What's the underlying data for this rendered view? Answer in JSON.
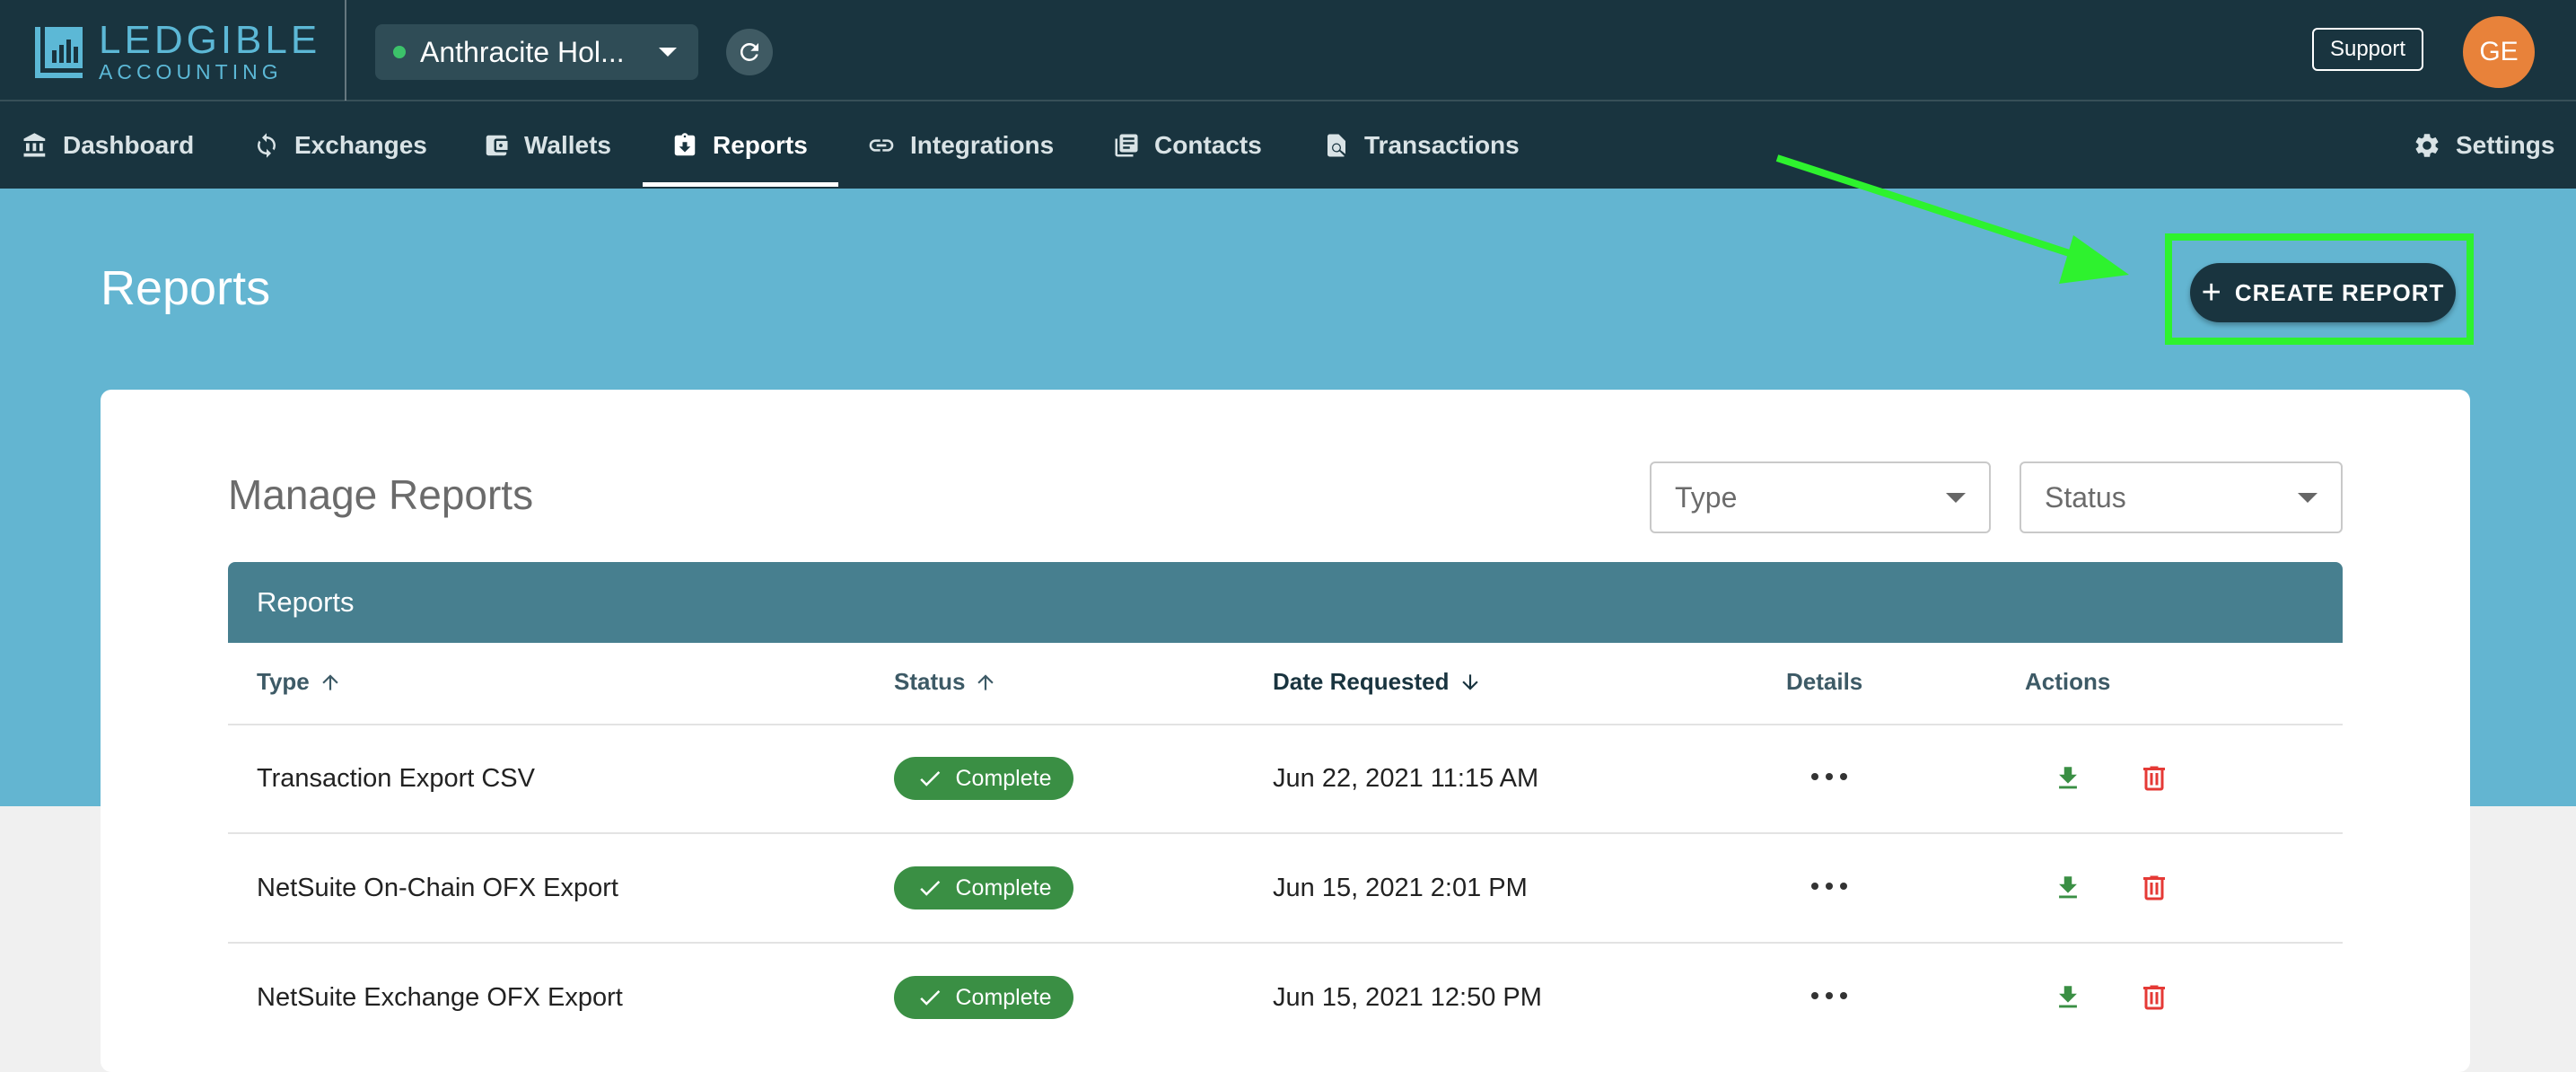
{
  "header": {
    "logo": {
      "line1": "LEDGIBLE",
      "line2": "ACCOUNTING",
      "icon": "ledgible-logo-icon"
    },
    "entity": {
      "name": "Anthracite Hol...",
      "status_color": "#3cc26a"
    },
    "support_label": "Support",
    "avatar_initials": "GE",
    "avatar_color": "#e8823a"
  },
  "nav": {
    "items": [
      {
        "label": "Dashboard",
        "icon": "bank-icon"
      },
      {
        "label": "Exchanges",
        "icon": "sync-icon"
      },
      {
        "label": "Wallets",
        "icon": "wallet-icon"
      },
      {
        "label": "Reports",
        "icon": "report-icon",
        "active": true
      },
      {
        "label": "Integrations",
        "icon": "link-icon"
      },
      {
        "label": "Contacts",
        "icon": "contacts-icon"
      },
      {
        "label": "Transactions",
        "icon": "search-document-icon"
      }
    ],
    "settings_label": "Settings"
  },
  "page": {
    "title": "Reports",
    "create_button": "CREATE REPORT"
  },
  "manage": {
    "title": "Manage Reports",
    "filters": {
      "type_placeholder": "Type",
      "status_placeholder": "Status"
    }
  },
  "table": {
    "title": "Reports",
    "columns": [
      {
        "label": "Type",
        "sort": "asc"
      },
      {
        "label": "Status",
        "sort": "asc"
      },
      {
        "label": "Date Requested",
        "sort": "desc"
      },
      {
        "label": "Details"
      },
      {
        "label": "Actions"
      }
    ],
    "rows": [
      {
        "type": "Transaction Export CSV",
        "status": "Complete",
        "date": "Jun 22, 2021 11:15 AM"
      },
      {
        "type": "NetSuite On-Chain OFX Export",
        "status": "Complete",
        "date": "Jun 15, 2021 2:01 PM"
      },
      {
        "type": "NetSuite Exchange OFX Export",
        "status": "Complete",
        "date": "Jun 15, 2021 12:50 PM"
      }
    ]
  },
  "colors": {
    "header_bg": "#19343f",
    "hero_bg": "#63b5d1",
    "table_header_bg": "#477f8f",
    "status_complete": "#3a8f44",
    "download_icon": "#3a8f44",
    "delete_icon": "#e53935",
    "annotation": "#2ef22e"
  }
}
